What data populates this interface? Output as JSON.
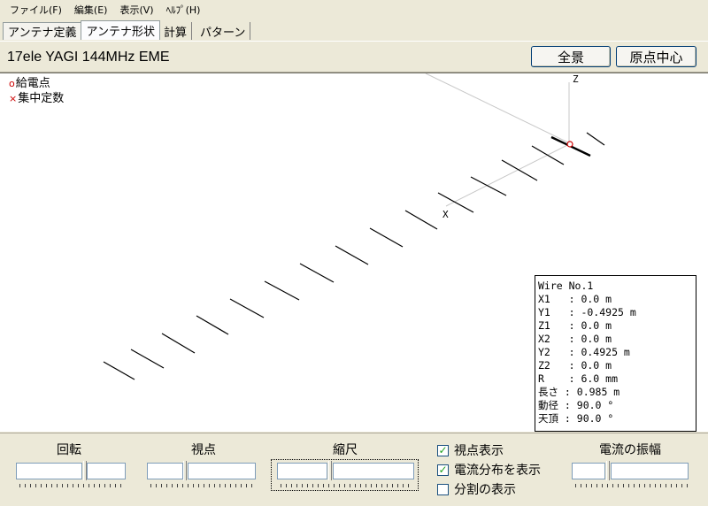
{
  "menu": [
    "ファイル(F)",
    "編集(E)",
    "表示(V)",
    "ﾍﾙﾌﾟ(H)"
  ],
  "tabs": [
    "アンテナ定義",
    "アンテナ形状",
    "計算",
    "パターン"
  ],
  "active_tab": "アンテナ形状",
  "antenna_title": "17ele YAGI 144MHz EME",
  "buttons": {
    "fullview": "全景",
    "origin_center": "原点中心"
  },
  "legend": {
    "feed_mark": "o",
    "feed_label": "給電点",
    "lumped_mark": "×",
    "lumped_label": "集中定数"
  },
  "axes": {
    "z": "Z",
    "x": "X"
  },
  "wire_info": [
    "Wire No.1",
    "X1   : 0.0 m",
    "Y1   : -0.4925 m",
    "Z1   : 0.0 m",
    "X2   : 0.0 m",
    "Y2   : 0.4925 m",
    "Z2   : 0.0 m",
    "R    : 6.0 mm",
    "長さ : 0.985 m",
    "動径 : 90.0 °",
    "天頂 : 90.0 °"
  ],
  "controls": {
    "rotation": "回転",
    "viewpoint": "視点",
    "scale": "縮尺",
    "current_amplitude": "電流の振幅",
    "show_viewpoint": "視点表示",
    "show_current": "電流分布を表示",
    "show_division": "分割の表示",
    "show_viewpoint_checked": true,
    "show_current_checked": true,
    "show_division_checked": false
  },
  "colors": {
    "feed": "#cc0000",
    "lumped": "#cc0000",
    "accent": "#003c74"
  }
}
